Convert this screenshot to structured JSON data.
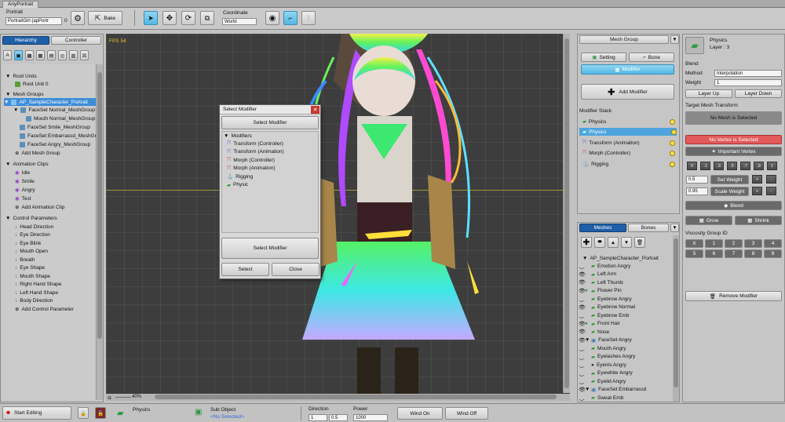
{
  "window": {
    "title": "AnyPortrait"
  },
  "toolbar": {
    "portrait_label": "Portrait",
    "portrait_value": "PortraitGirl (apPortr",
    "bake_label": "Bake",
    "coordinate_label": "Coordinate",
    "coordinate_value": "World",
    "zero": "0"
  },
  "left": {
    "tabs": [
      "Hierarchy",
      "Controller"
    ],
    "root_units_header": "Root Units",
    "root_unit": "Root Unit 0",
    "mesh_groups_header": "Mesh Groups",
    "mesh_groups": [
      "AP_SampleCharacter_Portrait",
      "FaceSet Normal_MeshGroup",
      "Mouth Normal_MeshGroup",
      "FaceSet Smile_MeshGroup",
      "FaceSet Embarrassd_MeshGrou",
      "FaceSet Angry_MeshGroup"
    ],
    "add_mesh_group": "Add Mesh Group",
    "animation_header": "Animation Clips",
    "animations": [
      "Idle",
      "Smile",
      "Angry",
      "Test"
    ],
    "add_animation": "Add Animation Clip",
    "params_header": "Control Parameters",
    "params": [
      "Head Direction",
      "Eye Direction",
      "Eye Blink",
      "Mouth Open",
      "Breath",
      "Eye Shape",
      "Mouth Shape",
      "Right Hand Shape",
      "Left Hand Shape",
      "Body Direction"
    ],
    "add_param": "Add Control Parameter"
  },
  "viewport": {
    "fps": "FPS 54",
    "zoom": "40%"
  },
  "dialog": {
    "title": "Select Modifier",
    "header": "Select Modifier",
    "modifiers_header": "Modifiers",
    "items": [
      "Transform (Controller)",
      "Transform (Animation)",
      "Morph (Controller)",
      "Morph (Animation)",
      "Rigging",
      "Physic"
    ],
    "select_modifier_btn": "Select Modifier",
    "select_btn": "Select",
    "close_btn": "Close"
  },
  "mesh_group_panel": {
    "title": "Mesh Group",
    "setting": "Setting",
    "bone": "Bone",
    "modifier": "Modifier",
    "add_modifier": "Add Modifier",
    "stack_label": "Modifier Stack",
    "stack": [
      "Physics",
      "Physics",
      "Transform (Animation)",
      "Morph (Controller)",
      "Rigging"
    ]
  },
  "meshes_panel": {
    "tabs": [
      "Meshes",
      "Bones"
    ],
    "root": "AP_SampleCharacter_Portrait",
    "items": [
      "Emotion Angry",
      "Left Arm",
      "Left Thumb",
      "Flower Pin",
      "Eyebrow Angry",
      "Eyebrow Normal",
      "Eyebrow Emb",
      "Front Hair",
      "Nose",
      "FaceSet Angry",
      "Mouth Angry",
      "Eyelashes Angry",
      "Eyeiris Angry",
      "Eyewhite Angry",
      "Eyelid Angry",
      "FaceSet Embarrassd",
      "Sweat Emb"
    ]
  },
  "right": {
    "name": "Physics",
    "layer": "Layer : 3",
    "blend_label": "Blend",
    "method_label": "Method",
    "method_value": "Interpolation",
    "weight_label": "Weight",
    "weight_value": "1",
    "layer_up": "Layer Up",
    "layer_down": "Layer Down",
    "target_label": "Target Mesh Transform",
    "no_mesh": "No Mesh is Selected",
    "no_vertex": "No Vertex is Selected",
    "important_vertex": "Important Vertex",
    "num_buttons": [
      "0",
      ".1",
      ".3",
      ".5",
      ".7",
      ".9",
      "1"
    ],
    "weight_a": "0.5",
    "set_weight": "Set Weight",
    "weight_b": "0.95",
    "scale_weight": "Scale Weight",
    "plus": "+",
    "minus": "-",
    "blend_btn": "Blend",
    "grow": "Grow",
    "shrink": "Shrink",
    "viscosity_label": "Viscosity Group ID",
    "vis_row1": [
      "X",
      "1",
      "2",
      "3",
      "4"
    ],
    "vis_row2": [
      "5",
      "6",
      "7",
      "8",
      "9"
    ],
    "remove_modifier": "Remove Modifier"
  },
  "bottom": {
    "start_editing": "Start Editing",
    "physics": "Physics",
    "sub_object": "Sub Object",
    "no_selected": "<No Selected>",
    "direction_label": "Direction",
    "dir_x": "1",
    "dir_y": "0.5",
    "power_label": "Power",
    "power_value": "1000",
    "wind_on": "Wind On",
    "wind_off": "Wind Off"
  }
}
